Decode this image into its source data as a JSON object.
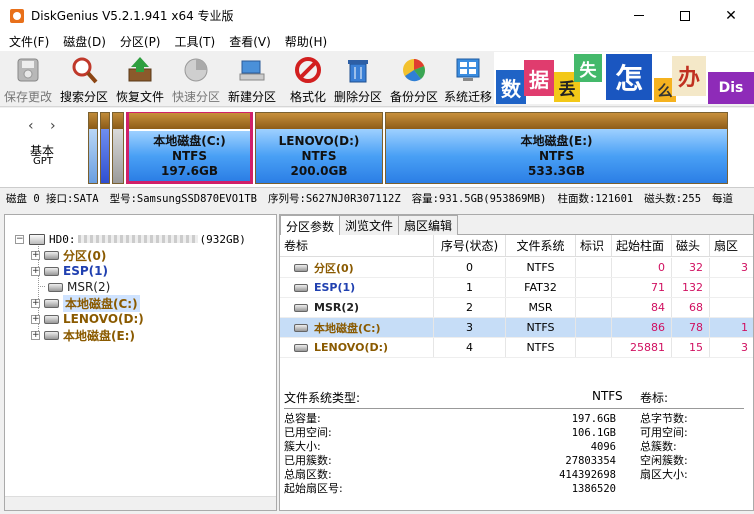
{
  "window": {
    "title": "DiskGenius V5.2.1.941 x64 专业版"
  },
  "menu": [
    "文件(F)",
    "磁盘(D)",
    "分区(P)",
    "工具(T)",
    "查看(V)",
    "帮助(H)"
  ],
  "toolbar": [
    {
      "label": "保存更改",
      "icon": "save-icon",
      "enabled": false
    },
    {
      "label": "搜索分区",
      "icon": "magnifier-icon",
      "enabled": true
    },
    {
      "label": "恢复文件",
      "icon": "recover-box-icon",
      "enabled": true
    },
    {
      "label": "快速分区",
      "icon": "quick-partition-icon",
      "enabled": false
    },
    {
      "label": "新建分区",
      "icon": "new-partition-icon",
      "enabled": true
    },
    {
      "label": "格式化",
      "icon": "format-icon",
      "enabled": true
    },
    {
      "label": "删除分区",
      "icon": "trash-icon",
      "enabled": true
    },
    {
      "label": "备份分区",
      "icon": "backup-pie-icon",
      "enabled": true
    },
    {
      "label": "系统迁移",
      "icon": "system-migrate-icon",
      "enabled": true
    }
  ],
  "banner": {
    "tiles": [
      "数",
      "据",
      "丢",
      "失",
      "怎",
      "么",
      "办",
      "Dis"
    ]
  },
  "diskmap": {
    "disk_type": "基本",
    "disk_style": "GPT",
    "partitions": [
      {
        "name": "本地磁盘(C:)",
        "fs": "NTFS",
        "size": "197.6GB",
        "selected": true
      },
      {
        "name": "LENOVO(D:)",
        "fs": "NTFS",
        "size": "200.0GB",
        "selected": false
      },
      {
        "name": "本地磁盘(E:)",
        "fs": "NTFS",
        "size": "533.3GB",
        "selected": false
      }
    ]
  },
  "diskinfo": {
    "disk": "磁盘 0 接口:SATA",
    "model": "型号:SamsungSSD870EVO1TB",
    "serial": "序列号:S627NJ0R307112Z",
    "capacity": "容量:931.5GB(953869MB)",
    "cylinders": "柱面数:121601",
    "heads": "磁头数:255",
    "sectors": "每道"
  },
  "tree": {
    "root": "HD0:",
    "root_size": "(932GB)",
    "items": [
      {
        "label": "分区(0)",
        "color": "brown",
        "expandable": true
      },
      {
        "label": "ESP(1)",
        "color": "blue",
        "expandable": true
      },
      {
        "label": "MSR(2)",
        "color": "plain",
        "expandable": false
      },
      {
        "label": "本地磁盘(C:)",
        "color": "brown",
        "expandable": true,
        "selected": true
      },
      {
        "label": "LENOVO(D:)",
        "color": "brown",
        "expandable": true
      },
      {
        "label": "本地磁盘(E:)",
        "color": "brown",
        "expandable": true
      }
    ]
  },
  "tabs": [
    "分区参数",
    "浏览文件",
    "扇区编辑"
  ],
  "grid": {
    "headers": [
      "卷标",
      "序号(状态)",
      "文件系统",
      "标识",
      "起始柱面",
      "磁头",
      "扇区"
    ],
    "rows": [
      {
        "label": "分区(0)",
        "color": "brown",
        "index": "0",
        "fs": "NTFS",
        "flag": "",
        "cyl": "0",
        "head": "32",
        "sec": "3"
      },
      {
        "label": "ESP(1)",
        "color": "blue",
        "index": "1",
        "fs": "FAT32",
        "flag": "",
        "cyl": "71",
        "head": "132",
        "sec": ""
      },
      {
        "label": "MSR(2)",
        "color": "plain",
        "index": "2",
        "fs": "MSR",
        "flag": "",
        "cyl": "84",
        "head": "68",
        "sec": ""
      },
      {
        "label": "本地磁盘(C:)",
        "color": "brown",
        "index": "3",
        "fs": "NTFS",
        "flag": "",
        "cyl": "86",
        "head": "78",
        "sec": "1",
        "selected": true
      },
      {
        "label": "LENOVO(D:)",
        "color": "brown",
        "index": "4",
        "fs": "NTFS",
        "flag": "",
        "cyl": "25881",
        "head": "15",
        "sec": "3"
      }
    ]
  },
  "details": {
    "fs_type_label": "文件系统类型:",
    "fs_type_value": "NTFS",
    "volume_label": "卷标:",
    "rows": [
      {
        "label": "总容量:",
        "value": "197.6GB",
        "right": "总字节数:"
      },
      {
        "label": "已用空间:",
        "value": "106.1GB",
        "right": "可用空间:"
      },
      {
        "label": "簇大小:",
        "value": "4096",
        "right": "总簇数:"
      },
      {
        "label": "已用簇数:",
        "value": "27803354",
        "right": "空闲簇数:"
      },
      {
        "label": "总扇区数:",
        "value": "414392698",
        "right": "扇区大小:"
      },
      {
        "label": "起始扇区号:",
        "value": "1386520",
        "right": ""
      }
    ]
  }
}
